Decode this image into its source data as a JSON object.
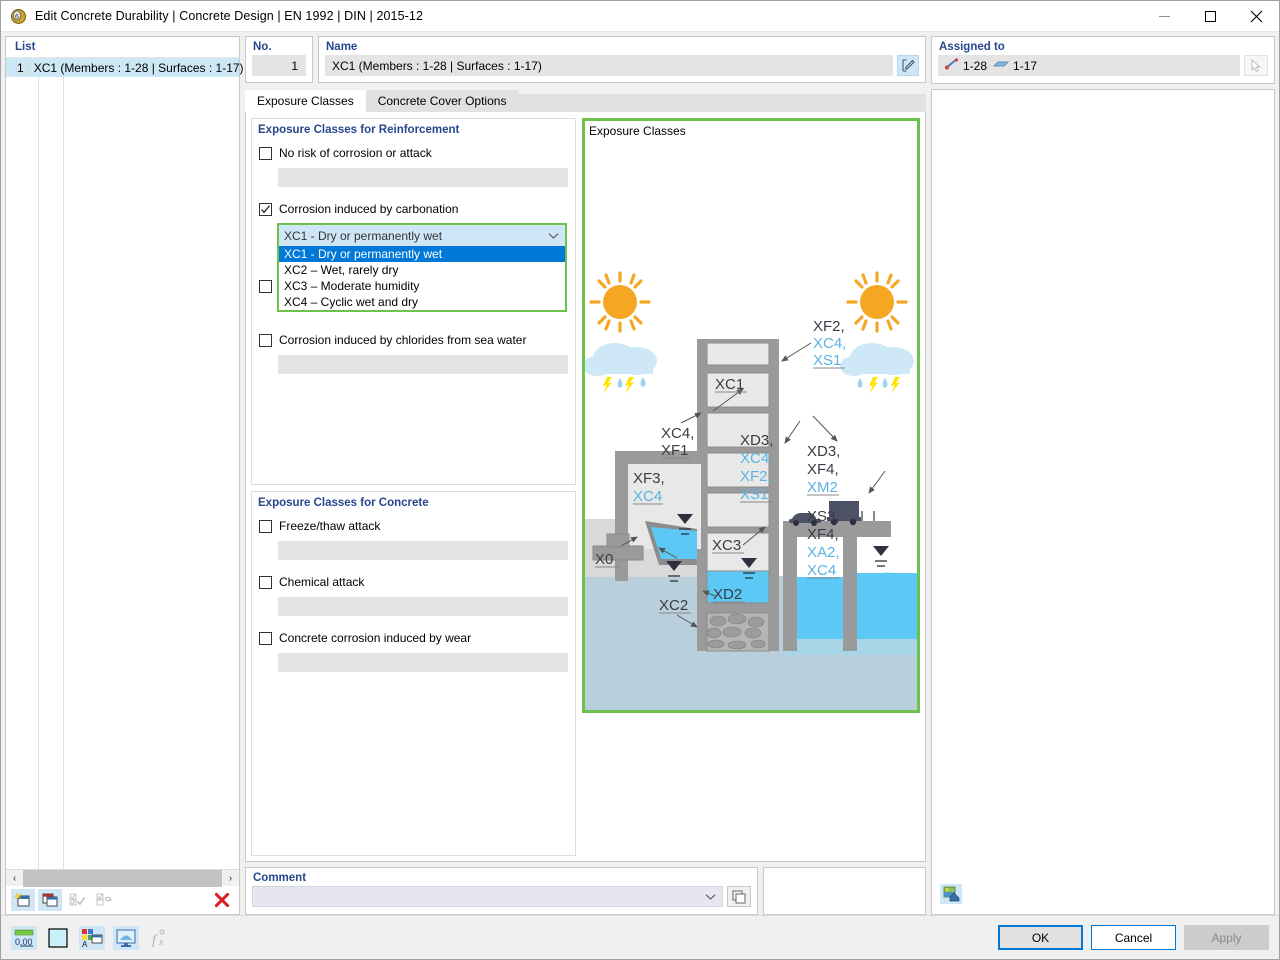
{
  "window": {
    "title": "Edit Concrete Durability | Concrete Design | EN 1992 | DIN | 2015-12",
    "app_icon": "concrete-durability-icon",
    "minimize": "minimize-icon",
    "maximize": "maximize-icon",
    "close": "close-icon"
  },
  "list": {
    "header": "List",
    "rows": [
      {
        "num": "1",
        "label": "XC1 (Members : 1-28 | Surfaces : 1-17)"
      }
    ],
    "scroll_left": "‹",
    "scroll_right": "›",
    "toolbar": [
      {
        "name": "new-item-button",
        "icon": "new-window-icon",
        "enabled": true
      },
      {
        "name": "copy-item-button",
        "icon": "copy-window-icon",
        "enabled": true
      },
      {
        "name": "select-all-button",
        "icon": "check-all-icon",
        "enabled": false
      },
      {
        "name": "invert-selection-button",
        "icon": "invert-selection-icon",
        "enabled": false
      },
      {
        "name": "delete-item-button",
        "icon": "red-x-icon",
        "enabled": true
      }
    ]
  },
  "no_field": {
    "label": "No.",
    "value": "1"
  },
  "name_field": {
    "label": "Name",
    "value": "XC1 (Members : 1-28 | Surfaces : 1-17)",
    "edit_icon": "edit-pencil-icon"
  },
  "assigned_to": {
    "label": "Assigned to",
    "members": "1-28",
    "surfaces": "1-17",
    "member_icon": "member-line-icon",
    "surface_icon": "surface-icon",
    "pick_icon": "pick-cursor-icon"
  },
  "tabs": [
    {
      "label": "Exposure Classes",
      "active": true
    },
    {
      "label": "Concrete Cover Options",
      "active": false
    }
  ],
  "reinforcement_group": {
    "legend": "Exposure Classes for Reinforcement",
    "items": [
      {
        "label": "No risk of corrosion or attack",
        "checked": false,
        "has_combo": false
      },
      {
        "label": "Corrosion induced by carbonation",
        "checked": true,
        "has_combo": true
      },
      {
        "label": "",
        "checked": false,
        "has_combo": false
      },
      {
        "label": "Corrosion induced by chlorides from sea water",
        "checked": false,
        "has_combo": false
      }
    ]
  },
  "carbonation_combo": {
    "selected": "XC1 - Dry or permanently wet",
    "chevron": "chevron-down-icon",
    "options": [
      {
        "label": "XC1 - Dry or permanently wet",
        "highlighted": true
      },
      {
        "label": "XC2 – Wet, rarely dry",
        "highlighted": false
      },
      {
        "label": "XC3 – Moderate humidity",
        "highlighted": false
      },
      {
        "label": "XC4 – Cyclic wet and dry",
        "highlighted": false
      }
    ]
  },
  "concrete_group": {
    "legend": "Exposure Classes for Concrete",
    "items": [
      {
        "label": "Freeze/thaw attack",
        "checked": false
      },
      {
        "label": "Chemical attack",
        "checked": false
      },
      {
        "label": "Concrete corrosion induced by wear",
        "checked": false
      }
    ]
  },
  "comment": {
    "label": "Comment",
    "value": "",
    "chevron": "chevron-down-icon",
    "copy_icon": "copy-icon"
  },
  "preview": {
    "title": "Exposure Classes",
    "image_button_icon": "image-export-icon",
    "labels": [
      {
        "text": "XF2,",
        "color": "dark"
      },
      {
        "text": "XC4,",
        "color": "blue"
      },
      {
        "text": "XS1",
        "color": "blue"
      },
      {
        "text": "XC4,",
        "color": "dark"
      },
      {
        "text": "XF1",
        "color": "dark"
      },
      {
        "text": "XF3,",
        "color": "dark"
      },
      {
        "text": "XC4",
        "color": "blue"
      },
      {
        "text": "X0",
        "color": "dark"
      },
      {
        "text": "XC1",
        "color": "dark"
      },
      {
        "text": "XC2",
        "color": "dark"
      },
      {
        "text": "XC3",
        "color": "dark"
      },
      {
        "text": "XD2",
        "color": "dark"
      },
      {
        "text": "XD3,",
        "color": "dark"
      },
      {
        "text": "XC4,",
        "color": "blue"
      },
      {
        "text": "XF2,",
        "color": "blue"
      },
      {
        "text": "XS1",
        "color": "blue"
      },
      {
        "text": "XD3,",
        "color": "dark"
      },
      {
        "text": "XF4,",
        "color": "dark"
      },
      {
        "text": "XM2",
        "color": "blue"
      },
      {
        "text": "XS3,",
        "color": "dark"
      },
      {
        "text": "XF4,",
        "color": "dark"
      },
      {
        "text": "XA2,",
        "color": "blue"
      },
      {
        "text": "XC4",
        "color": "blue"
      }
    ]
  },
  "status_bar": {
    "buttons": [
      {
        "name": "numeric-precision-button",
        "icon": "ruler-000-icon"
      },
      {
        "name": "color-swatch-button",
        "icon": "color-swatch-icon"
      },
      {
        "name": "render-style-button",
        "icon": "color-style-icon"
      },
      {
        "name": "display-properties-button",
        "icon": "monitor-icon"
      },
      {
        "name": "formula-button",
        "icon": "fx-icon"
      }
    ]
  },
  "dialog_buttons": {
    "ok": "OK",
    "cancel": "Cancel",
    "apply": "Apply"
  },
  "colors": {
    "accent_blue": "#0078d7",
    "green_highlight": "#6cc24a",
    "legend_blue": "#26478d",
    "selection_blue": "#cce8f4",
    "diagram_blue_text": "#5bb3e4",
    "sun_orange": "#f5a623",
    "water_blue": "#5bc8f5"
  }
}
